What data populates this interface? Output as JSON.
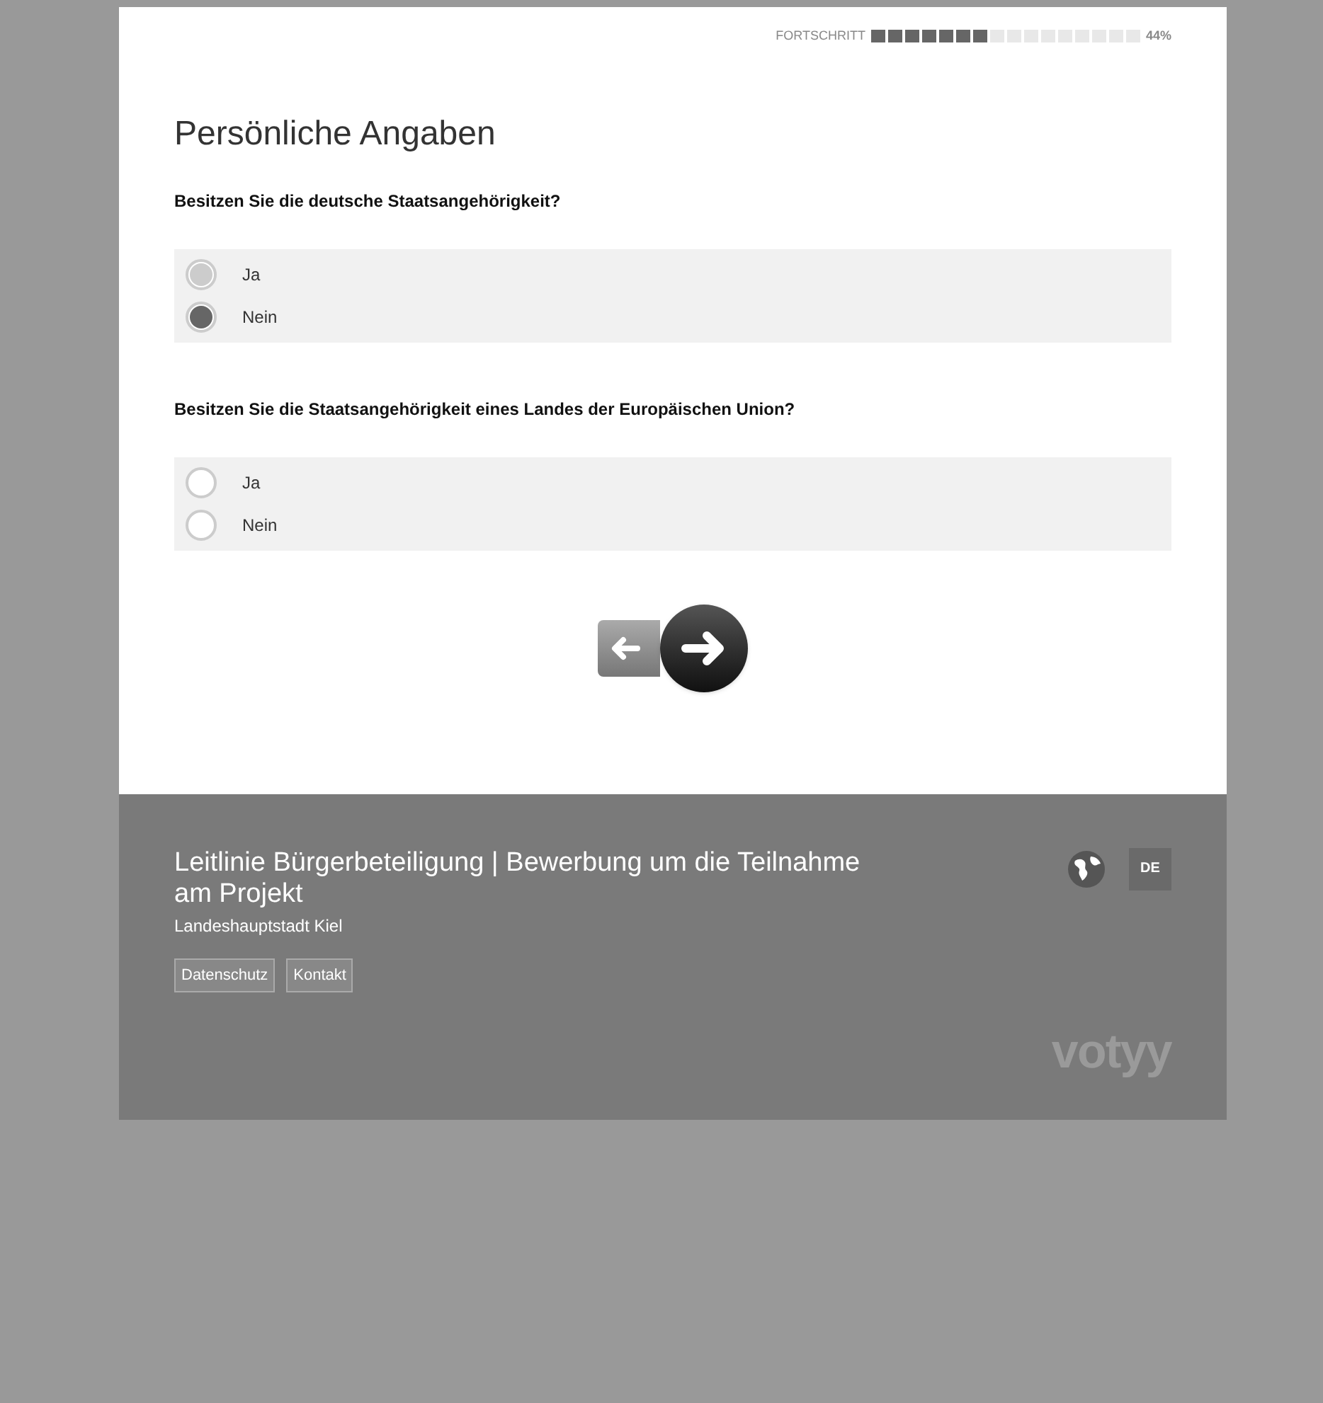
{
  "progress": {
    "label": "FORTSCHRITT",
    "level": 0.44,
    "reading": "44%"
  },
  "title": "Persönliche Angaben",
  "questions": [
    {
      "text": "Besitzen Sie die deutsche Staatsangehörigkeit?",
      "options": [
        {
          "label": "Ja",
          "selected": false
        },
        {
          "label": "Nein",
          "selected": true
        }
      ]
    },
    {
      "text": "Besitzen Sie die Staatsangehörigkeit eines Landes der Europäischen Union?",
      "options": [
        {
          "label": "Ja",
          "selected": false
        },
        {
          "label": "Nein",
          "selected": false
        }
      ]
    }
  ],
  "footer": {
    "title": "Leitlinie Bürgerbeteiligung | Bewerbung um die Teilnahme am Projekt",
    "subtitle": "Landeshauptstadt Kiel",
    "links": [
      "Datenschutz",
      "Kontakt"
    ],
    "language": "DE",
    "logo": "votyy"
  }
}
